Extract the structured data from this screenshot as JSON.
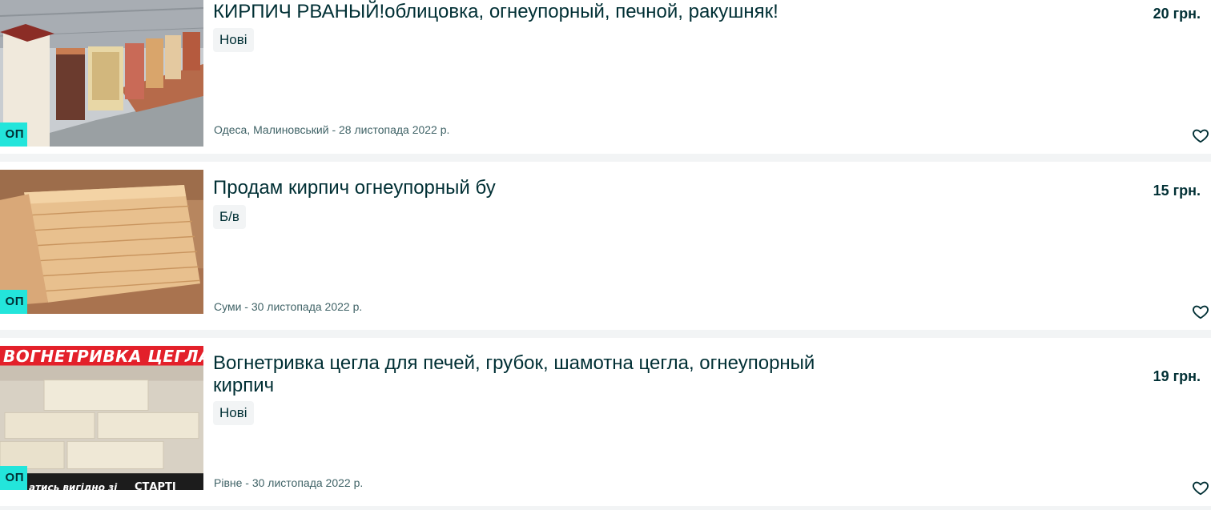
{
  "listings": [
    {
      "title": "КИРПИЧ РВАНЫЙ!облицовка, огнеупорный, печной, ракушняк!",
      "condition": "Нові",
      "location_date": "Одеса, Малиновський - 28 листопада 2022 р.",
      "price": "20 грн.",
      "badge": "ОП"
    },
    {
      "title": "Продам кирпич огнеупорный бу",
      "condition": "Б/в",
      "location_date": "Суми - 30 листопада 2022 р.",
      "price": "15 грн.",
      "badge": "ОП"
    },
    {
      "title": "Вогнетривка цегла для печей, грубок, шамотна цегла, огнеупорный кирпич",
      "condition": "Нові",
      "location_date": "Рівне - 30 листопада 2022 р.",
      "price": "19 грн.",
      "badge": "ОП",
      "image_banner": "ВОГНЕТРИВКА ЦЕГЛА",
      "image_footer": "атись вигідно зі",
      "image_logo": "СТАРТІ"
    }
  ],
  "icons": {
    "favorite": "heart-outline-icon"
  },
  "colors": {
    "badge": "#23e5db",
    "text": "#002f34",
    "muted": "#406367",
    "banner": "#e3202a"
  }
}
